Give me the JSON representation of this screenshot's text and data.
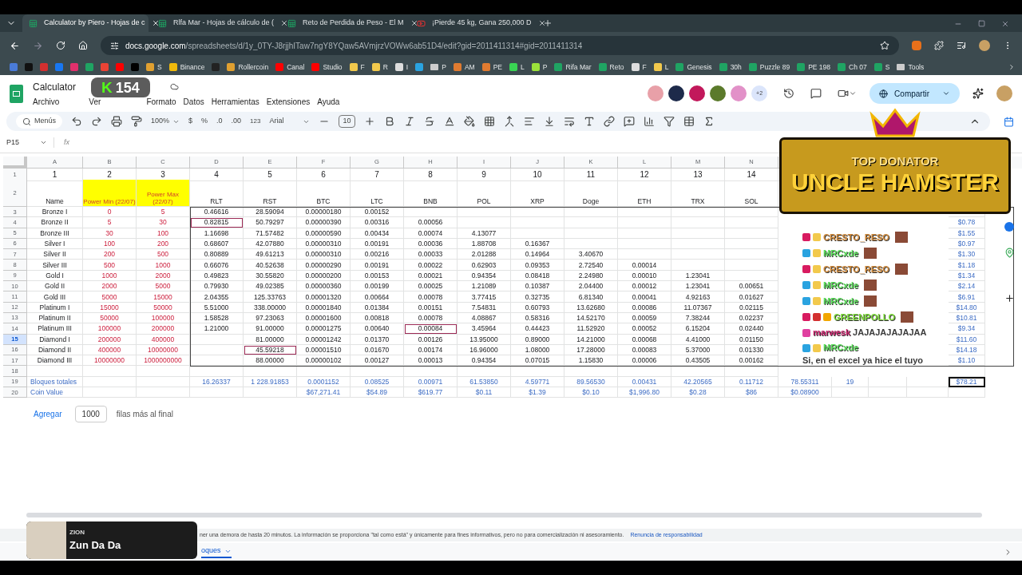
{
  "tabs": [
    {
      "title": "Calculator by Piero - Hojas de c",
      "kind": "sheets",
      "selected": true
    },
    {
      "title": "Rlfa Mar - Hojas de cálculo de (",
      "kind": "sheets",
      "selected": false
    },
    {
      "title": "Reto de Perdida de Peso - El M",
      "kind": "sheets",
      "selected": false
    },
    {
      "title": "¡Pierde 45 kg, Gana 250,000 D",
      "kind": "youtube",
      "selected": false
    }
  ],
  "url": {
    "host": "docs.google.com",
    "path": "/spreadsheets/d/1y_0TY-J8rjjhITaw7ngY8YQaw5AVmjrzVOWw6ab51D4/edit?gid=2011411314#gid=2011411314"
  },
  "bookmarks": [
    {
      "kind": "site",
      "color": "#4a7bd8"
    },
    {
      "kind": "site",
      "color": "#111111"
    },
    {
      "kind": "site",
      "color": "#d32f2f"
    },
    {
      "kind": "site",
      "color": "#1877f2"
    },
    {
      "kind": "site",
      "color": "#e1306c"
    },
    {
      "kind": "site",
      "color": "#1fa463"
    },
    {
      "kind": "site",
      "color": "#ea4335"
    },
    {
      "kind": "site",
      "color": "#ff0000"
    },
    {
      "kind": "site",
      "color": "#000000"
    },
    {
      "kind": "site",
      "color": "#e0a030",
      "label": "S"
    },
    {
      "kind": "site",
      "color": "#f0b90b",
      "label": "Binance"
    },
    {
      "kind": "site",
      "color": "#222222"
    },
    {
      "kind": "site",
      "color": "#e0a030",
      "label": "Rollercoin"
    },
    {
      "kind": "site",
      "color": "#ff0000",
      "label": "Canal"
    },
    {
      "kind": "site",
      "color": "#ff0000",
      "label": "Studio"
    },
    {
      "kind": "site",
      "color": "#f2c94c",
      "label": "F"
    },
    {
      "kind": "site",
      "color": "#f2c94c",
      "label": "R"
    },
    {
      "kind": "site",
      "color": "#dddddd",
      "label": "I"
    },
    {
      "kind": "site",
      "color": "#2aa3e0"
    },
    {
      "kind": "folder",
      "color": "#cccccc",
      "label": "P"
    },
    {
      "kind": "site",
      "color": "#e07b30",
      "label": "AM"
    },
    {
      "kind": "site",
      "color": "#e07b30",
      "label": "PE"
    },
    {
      "kind": "site",
      "color": "#39d353",
      "label": "L"
    },
    {
      "kind": "site",
      "color": "#9be23a",
      "label": "P"
    },
    {
      "kind": "site",
      "color": "#1fa463",
      "label": "Rifa Mar"
    },
    {
      "kind": "site",
      "color": "#1fa463",
      "label": "Reto"
    },
    {
      "kind": "site",
      "color": "#dddddd",
      "label": "F"
    },
    {
      "kind": "site",
      "color": "#f2c94c",
      "label": "L"
    },
    {
      "kind": "site",
      "color": "#1fa463",
      "label": "Genesis"
    },
    {
      "kind": "site",
      "color": "#1fa463",
      "label": "30h"
    },
    {
      "kind": "site",
      "color": "#1fa463",
      "label": "Puzzle 89"
    },
    {
      "kind": "site",
      "color": "#1fa463",
      "label": "PE 198"
    },
    {
      "kind": "site",
      "color": "#1fa463",
      "label": "Ch 07"
    },
    {
      "kind": "site",
      "color": "#1fa463",
      "label": "S"
    },
    {
      "kind": "folder",
      "color": "#cccccc",
      "label": "Tools"
    }
  ],
  "doc": {
    "title": "Calculator",
    "menus": [
      "Archivo",
      "Ver",
      "Formato",
      "Datos",
      "Herramientas",
      "Extensiones",
      "Ayuda"
    ],
    "share": "Compartir",
    "more_collaborators": "+2"
  },
  "collaborators": [
    {
      "color": "#e8a0a8"
    },
    {
      "color": "#1d2a4a"
    },
    {
      "color": "#c2185b"
    },
    {
      "color": "#5b7a2b"
    },
    {
      "color": "#e291c8"
    }
  ],
  "stream_badge": {
    "logo": "K",
    "count": "154"
  },
  "toolbar": {
    "search": "Menús",
    "zoom": "100%",
    "currency": "$",
    "percent": "%",
    "dec_less": ".0",
    "dec_more": ".00",
    "format": "123",
    "font": "Arial",
    "size": "10"
  },
  "name_box": "P15",
  "formula_label": "fx",
  "columns": [
    "A",
    "B",
    "C",
    "D",
    "E",
    "F",
    "G",
    "H",
    "I",
    "J",
    "K",
    "L",
    "M",
    "N"
  ],
  "rows": [
    {
      "number": "1",
      "kind": "index",
      "selected": false,
      "cells": {
        "A": "1",
        "B": "2",
        "C": "3",
        "D": "4",
        "E": "5",
        "F": "6",
        "G": "7",
        "H": "8",
        "I": "9",
        "J": "10",
        "K": "11",
        "L": "12",
        "M": "13",
        "N": "14"
      }
    },
    {
      "number": "2",
      "kind": "heading",
      "selected": false,
      "cells": {
        "A": "Name",
        "B": "Power Min (22/07)",
        "C": "Power Max (22/07)",
        "D": "RLT",
        "E": "RST",
        "F": "BTC",
        "G": "LTC",
        "H": "BNB",
        "I": "POL",
        "J": "XRP",
        "K": "Doge",
        "L": "ETH",
        "M": "TRX",
        "N": "SOL"
      }
    },
    {
      "number": "3",
      "kind": "tier",
      "selected": false,
      "cells": {
        "A": "Bronze I",
        "B": "0",
        "C": "5",
        "D": "0.46616",
        "E": "28.59094",
        "F": "0.00000180",
        "G": "0.00152"
      }
    },
    {
      "number": "4",
      "kind": "tier",
      "selected": false,
      "cells": {
        "A": "Bronze II",
        "B": "5",
        "C": "30",
        "D": {
          "text": "0.82815",
          "selected": true,
          "kind": "mark"
        },
        "E": "50.79297",
        "F": "0.00000390",
        "G": "0.00316",
        "H": "0.00056",
        "S": "$0.78"
      }
    },
    {
      "number": "5",
      "kind": "tier",
      "selected": false,
      "cells": {
        "A": "Bronze III",
        "B": "30",
        "C": "100",
        "D": "1.16698",
        "E": "71.57482",
        "F": "0.00000590",
        "G": "0.00434",
        "H": "0.00074",
        "I": "4.13077",
        "S": "$1.55"
      }
    },
    {
      "number": "6",
      "kind": "tier",
      "selected": false,
      "cells": {
        "A": "Silver I",
        "B": "100",
        "C": "200",
        "D": "0.68607",
        "E": "42.07880",
        "F": "0.00000310",
        "G": "0.00191",
        "H": "0.00036",
        "I": "1.88708",
        "J": "0.16367",
        "S": "$0.97"
      }
    },
    {
      "number": "7",
      "kind": "tier",
      "selected": false,
      "cells": {
        "A": "Silver II",
        "B": "200",
        "C": "500",
        "D": "0.80889",
        "E": "49.61213",
        "F": "0.00000310",
        "G": "0.00216",
        "H": "0.00033",
        "I": "2.01288",
        "J": "0.14964",
        "K": "3.40670",
        "S": "$1.30"
      }
    },
    {
      "number": "8",
      "kind": "tier",
      "selected": false,
      "cells": {
        "A": "Silver III",
        "B": "500",
        "C": "1000",
        "D": "0.66076",
        "E": "40.52638",
        "F": "0.00000290",
        "G": "0.00191",
        "H": "0.00022",
        "I": "0.62903",
        "J": "0.09353",
        "K": "2.72540",
        "L": "0.00014",
        "S": "$1.18"
      }
    },
    {
      "number": "9",
      "kind": "tier",
      "selected": false,
      "cells": {
        "A": "Gold I",
        "B": "1000",
        "C": "2000",
        "D": "0.49823",
        "E": "30.55820",
        "F": "0.00000200",
        "G": "0.00153",
        "H": "0.00021",
        "I": "0.94354",
        "J": "0.08418",
        "K": "2.24980",
        "L": "0.00010",
        "M": "1.23041",
        "S": "$1.34"
      }
    },
    {
      "number": "10",
      "kind": "tier",
      "selected": false,
      "cells": {
        "A": "Gold II",
        "B": "2000",
        "C": "5000",
        "D": "0.79930",
        "E": "49.02385",
        "F": "0.00000360",
        "G": "0.00199",
        "H": "0.00025",
        "I": "1.21089",
        "J": "0.10387",
        "K": "2.04400",
        "L": "0.00012",
        "M": "1.23041",
        "N": "0.00651",
        "S": "$2.14"
      }
    },
    {
      "number": "11",
      "kind": "tier",
      "selected": false,
      "cells": {
        "A": "Gold III",
        "B": "5000",
        "C": "15000",
        "D": "2.04355",
        "E": "125.33763",
        "F": "0.00001320",
        "G": "0.00664",
        "H": "0.00078",
        "I": "3.77415",
        "J": "0.32735",
        "K": "6.81340",
        "L": "0.00041",
        "M": "4.92163",
        "N": "0.01627",
        "S": "$6.91"
      }
    },
    {
      "number": "12",
      "kind": "tier",
      "selected": false,
      "cells": {
        "A": "Platinum I",
        "B": "15000",
        "C": "50000",
        "D": "5.51000",
        "E": "338.00000",
        "F": "0.00001840",
        "G": "0.01384",
        "H": "0.00151",
        "I": "7.54831",
        "J": "0.60793",
        "K": "13.62680",
        "L": "0.00086",
        "M": "11.07367",
        "N": "0.02115",
        "S": "$14.80"
      }
    },
    {
      "number": "13",
      "kind": "tier",
      "selected": false,
      "cells": {
        "A": "Platinum II",
        "B": "50000",
        "C": "100000",
        "D": "1.58528",
        "E": "97.23063",
        "F": "0.00001600",
        "G": "0.00818",
        "H": "0.00078",
        "I": "4.08867",
        "J": "0.58316",
        "K": "14.52170",
        "L": "0.00059",
        "M": "7.38244",
        "N": "0.02237",
        "S": "$10.81"
      }
    },
    {
      "number": "14",
      "kind": "tier",
      "selected": false,
      "cells": {
        "A": "Platinum III",
        "B": "100000",
        "C": "200000",
        "D": "1.21000",
        "E": "91.00000",
        "F": "0.00001275",
        "G": "0.00640",
        "H": {
          "text": "0.00084",
          "selected": true,
          "kind": "mark"
        },
        "I": "3.45964",
        "J": "0.44423",
        "K": "11.52920",
        "L": "0.00052",
        "M": "6.15204",
        "N": "0.02440",
        "S": "$9.34"
      }
    },
    {
      "number": "15",
      "kind": "tier",
      "selected": true,
      "cells": {
        "A": "Diamond I",
        "B": "200000",
        "C": "400000",
        "E": "81.00000",
        "F": "0.00001242",
        "G": "0.01370",
        "H": "0.00126",
        "I": "13.95000",
        "J": "0.89000",
        "K": "14.21000",
        "L": "0.00068",
        "M": "4.41000",
        "N": "0.01150",
        "S": "$11.60"
      }
    },
    {
      "number": "16",
      "kind": "tier",
      "selected": false,
      "cells": {
        "A": "Diamond II",
        "B": "400000",
        "C": "10000000",
        "E": {
          "text": "45.59218",
          "selected": true,
          "kind": "mark"
        },
        "F": "0.00001510",
        "G": "0.01670",
        "H": "0.00174",
        "I": "16.96000",
        "J": "1.08000",
        "K": "17.28000",
        "L": "0.00083",
        "M": "5.37000",
        "N": "0.01330",
        "S": "$14.18"
      }
    },
    {
      "number": "17",
      "kind": "tier",
      "selected": false,
      "cells": {
        "A": "Diamond III",
        "B": "10000000",
        "C": "1000000000",
        "E": "88.00000",
        "F": "0.00000102",
        "G": "0.00127",
        "H": "0.00013",
        "I": "0.94354",
        "J": "0.07015",
        "K": "1.15830",
        "L": "0.00006",
        "M": "0.43505",
        "N": "0.00162",
        "S": "$1.10"
      }
    },
    {
      "number": "18",
      "kind": "blank",
      "selected": false,
      "cells": {}
    },
    {
      "number": "19",
      "kind": "total",
      "selected": false,
      "cells": {
        "A": "Bloques totales",
        "D": "16.26337",
        "E": "1 228.91853",
        "F": "0.0001152",
        "G": "0.08525",
        "H": "0.00971",
        "I": "61.53850",
        "J": "4.59771",
        "K": "89.56530",
        "L": "0.00431",
        "M": "42.20565",
        "N": "0.11712",
        "O": "78.55311",
        "P": "19",
        "S": {
          "text": "$78.21",
          "selected": true,
          "kind": "cursor"
        }
      }
    },
    {
      "number": "20",
      "kind": "total",
      "selected": false,
      "cells": {
        "A": "Coin Value",
        "F": "$67,271.41",
        "G": "$54.89",
        "H": "$619.77",
        "I": "$0.11",
        "J": "$1.39",
        "K": "$0.10",
        "L": "$1,996.80",
        "M": "$0.28",
        "N": "$86",
        "O": "$0.08900"
      }
    }
  ],
  "add_rows": {
    "button": "Agregar",
    "value": "1000",
    "suffix": "filas más al final"
  },
  "banner": {
    "kicker": "TOP DONATOR",
    "name": "UNCLE HAMSTER"
  },
  "chat": [
    {
      "user": "CRESTO_RESO",
      "color": "#d08a3c",
      "emote": true,
      "badges": [
        {
          "color": "#d81b60"
        },
        {
          "color": "#f2c94c"
        }
      ]
    },
    {
      "user": "MRCxde",
      "color": "#5de05d",
      "emote": true,
      "badges": [
        {
          "color": "#2aa3e0"
        },
        {
          "color": "#f2c94c"
        }
      ]
    },
    {
      "user": "CRESTO_RESO",
      "color": "#d08a3c",
      "emote": true,
      "badges": [
        {
          "color": "#d81b60"
        },
        {
          "color": "#f2c94c"
        }
      ]
    },
    {
      "user": "MRCxde",
      "color": "#5de05d",
      "emote": true,
      "badges": [
        {
          "color": "#2aa3e0"
        },
        {
          "color": "#f2c94c"
        }
      ]
    },
    {
      "user": "MRCxde",
      "color": "#5de05d",
      "emote": true,
      "badges": [
        {
          "color": "#2aa3e0"
        },
        {
          "color": "#f2c94c"
        }
      ]
    },
    {
      "user": "GREENPOLLO",
      "color": "#7ddc3a",
      "emote": true,
      "badges": [
        {
          "color": "#d81b60"
        },
        {
          "color": "#d32f2f"
        },
        {
          "color": "#f2a600"
        }
      ]
    },
    {
      "user": "marwesk",
      "color": "#c8206a",
      "emote": false,
      "badges": [
        {
          "color": "#e040a0"
        }
      ],
      "text": "JAJAJAJAJAJAA"
    },
    {
      "user": "MRCxde",
      "color": "#5de05d",
      "emote": false,
      "badges": [
        {
          "color": "#2aa3e0"
        },
        {
          "color": "#f2c94c"
        }
      ],
      "text": "Si, en el excel ya hice el tuyo"
    }
  ],
  "disclaimer": {
    "text": "ner una demora de hasta 20 minutos. La información se proporciona \"tal como está\" y únicamente para fines informativos, pero no para comercialización ni asesoramiento.",
    "link": "Renuncia de responsabilidad"
  },
  "sheet_tab": "oques",
  "now_playing": {
    "artist": "ZION",
    "song": "Zun Da Da"
  }
}
